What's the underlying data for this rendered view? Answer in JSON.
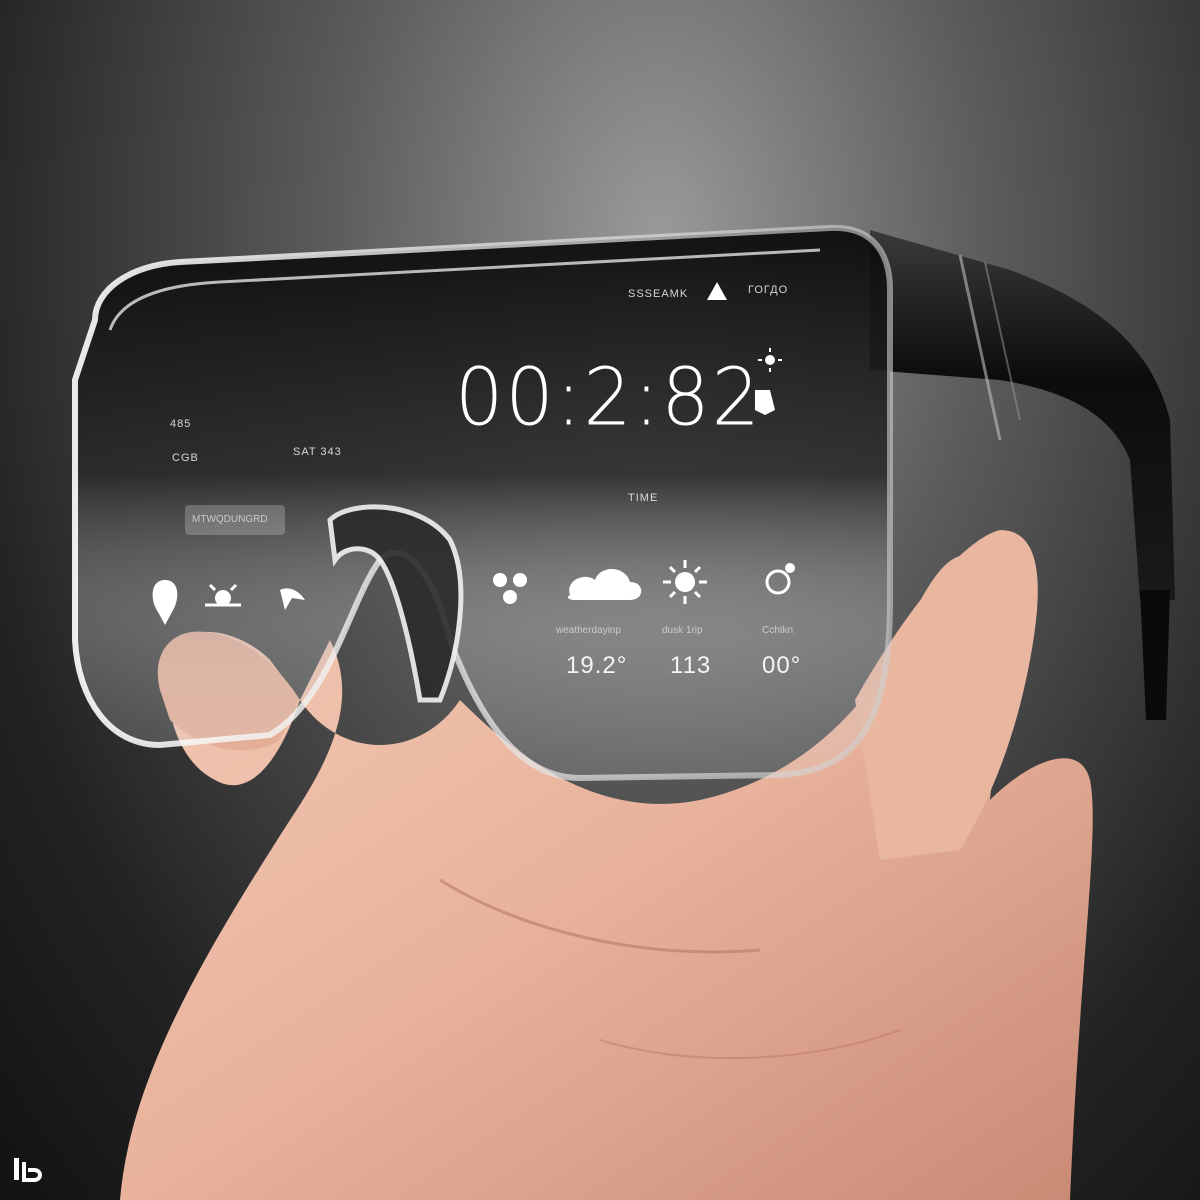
{
  "hud": {
    "status_left": "SSSEAMK",
    "status_right": "ГОГДО",
    "clock": "00:2:82",
    "section_label": "TIME",
    "tab_label": "MTWQDUNGRD",
    "left_top": "485",
    "left_mid": "CGB",
    "left_mid2": "SAT 343",
    "values": [
      "19.2°",
      "113",
      "00°"
    ],
    "captions": [
      "weatherdayinp",
      "dusk 1rip",
      "Cchtkn"
    ]
  },
  "icons": [
    "location-pin-icon",
    "sun-icon",
    "bird-icon",
    "molecule-icon",
    "cloud-icon",
    "sun-burst-icon",
    "sun-settings-icon",
    "alert-triangle-icon",
    "sun-small-icon",
    "speaker-icon"
  ],
  "colors": {
    "background": "#1c1c1c",
    "frame": "#0f0f0f",
    "skin": "#e9b9a3",
    "hud_text": "#f2f2f2"
  }
}
